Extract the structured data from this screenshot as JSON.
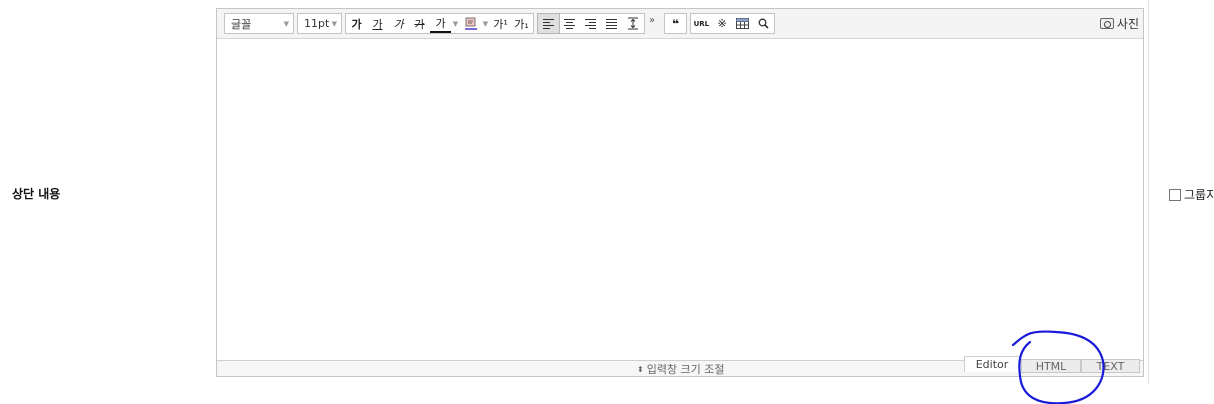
{
  "form": {
    "row_label": "상단 내용"
  },
  "toolbar": {
    "font_select": "글꼴",
    "size_select": "11pt",
    "bold": "가",
    "underline": "가",
    "italic": "가",
    "strike": "가",
    "font_color": "가",
    "superscript": "가¹",
    "subscript": "가₁",
    "more": "»",
    "quote": "❝",
    "url": "URL",
    "special_char": "※",
    "photo_label": "사진"
  },
  "resize_bar": {
    "label": "입력창 크기 조절"
  },
  "mode_tabs": [
    "Editor",
    "HTML",
    "TEXT"
  ],
  "side": {
    "checkbox_label": "그룹지"
  },
  "annotation": {
    "color": "#1a1adb"
  }
}
